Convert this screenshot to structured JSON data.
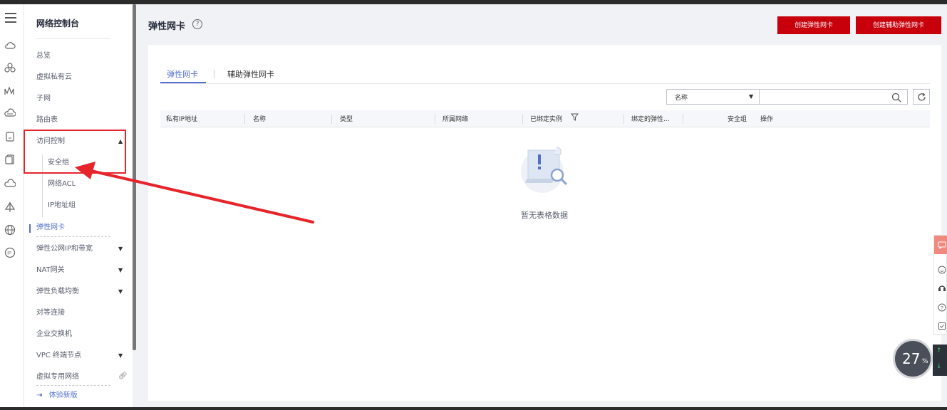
{
  "sidebar": {
    "title": "网络控制台",
    "items": [
      {
        "label": "总览"
      },
      {
        "label": "虚拟私有云"
      },
      {
        "label": "子网"
      },
      {
        "label": "路由表"
      },
      {
        "label": "访问控制"
      },
      {
        "label": "安全组"
      },
      {
        "label": "网络ACL"
      },
      {
        "label": "IP地址组"
      },
      {
        "label": "弹性网卡"
      },
      {
        "label": "弹性公网IP和带宽"
      },
      {
        "label": "NAT网关"
      },
      {
        "label": "弹性负载均衡"
      },
      {
        "label": "对等连接"
      },
      {
        "label": "企业交换机"
      },
      {
        "label": "VPC 终端节点"
      },
      {
        "label": "虚拟专用网络"
      }
    ],
    "try_new": "体验新版",
    "try_new_icon": "enter-icon"
  },
  "header": {
    "title": "弹性网卡",
    "help_icon": "question-circle-icon",
    "create_button": "创建弹性网卡",
    "create_aux_button": "创建辅助弹性网卡"
  },
  "tabs": [
    {
      "label": "弹性网卡",
      "active": true
    },
    {
      "label": "辅助弹性网卡",
      "active": false
    }
  ],
  "filter": {
    "selected": "名称",
    "placeholder": ""
  },
  "table": {
    "columns": [
      "私有IP地址",
      "名称",
      "类型",
      "所属网络",
      "已绑定实例",
      "绑定的弹性...",
      "安全组",
      "操作"
    ],
    "empty_text": "暂无表格数据"
  },
  "speed_widget": {
    "value": "27",
    "unit": "%"
  },
  "colors": {
    "primary_red": "#c7000b",
    "accent_blue": "#526ecc",
    "annotation_red": "#e5242b"
  }
}
